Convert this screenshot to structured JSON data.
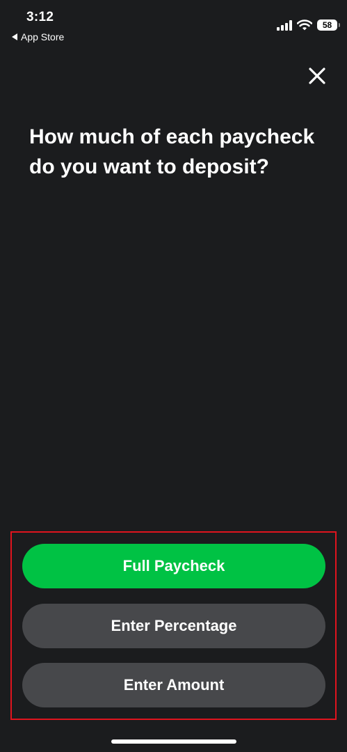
{
  "status_bar": {
    "time": "3:12",
    "back_label": "App Store",
    "battery_level": "58"
  },
  "question": "How much of each paycheck do you want to deposit?",
  "actions": {
    "full_paycheck": "Full Paycheck",
    "enter_percentage": "Enter Percentage",
    "enter_amount": "Enter Amount"
  },
  "colors": {
    "background": "#1b1c1e",
    "primary_button": "#00c244",
    "secondary_button": "#47484b",
    "highlight_border": "#e0141e"
  },
  "icons": {
    "close": "close-icon",
    "signal": "cellular-signal-icon",
    "wifi": "wifi-icon",
    "battery": "battery-icon",
    "back": "back-arrow-icon"
  }
}
